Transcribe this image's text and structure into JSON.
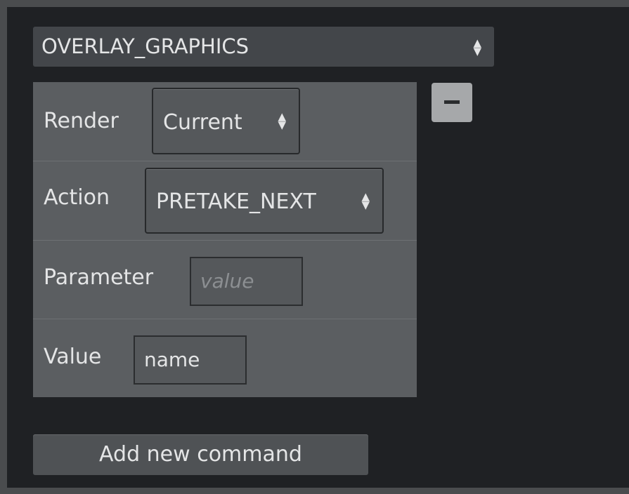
{
  "top_select": {
    "value": "OVERLAY_GRAPHICS",
    "icon": "updown-chevron-icon"
  },
  "command": {
    "render": {
      "label": "Render",
      "value": "Current"
    },
    "action": {
      "label": "Action",
      "value": "PRETAKE_NEXT"
    },
    "parameter": {
      "label": "Parameter",
      "placeholder": "value",
      "value": ""
    },
    "value": {
      "label": "Value",
      "value": "name"
    },
    "remove_icon": "minus-icon"
  },
  "add_button": {
    "label": "Add new command"
  },
  "colors": {
    "panel_bg": "#1f2124",
    "grid_bg": "#5b5e61",
    "text": "#e4e5e6"
  }
}
